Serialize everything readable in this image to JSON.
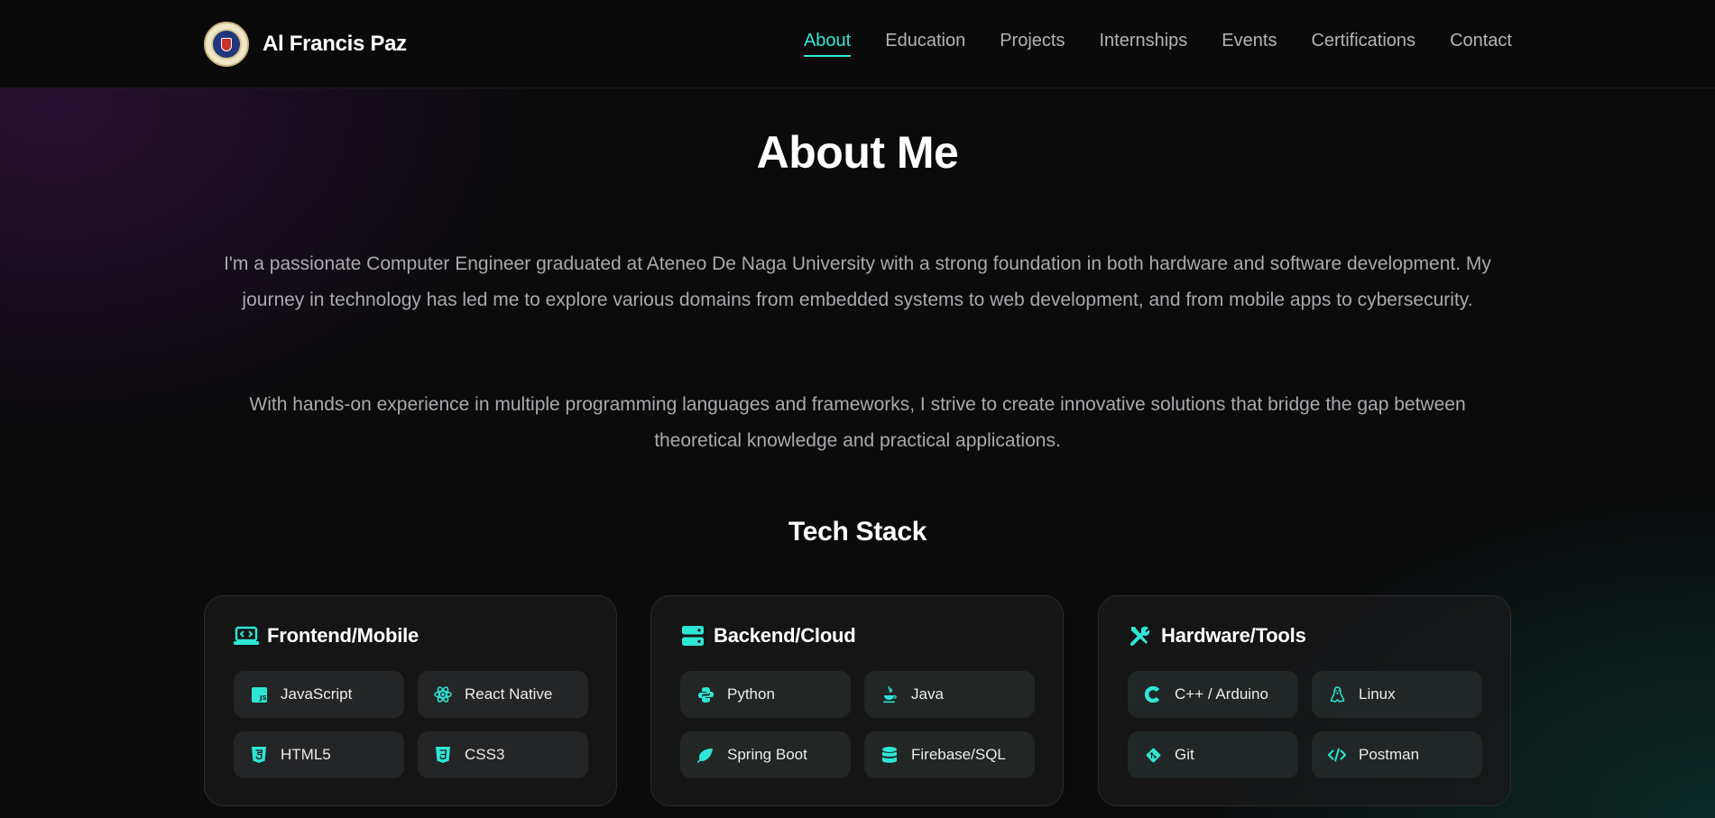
{
  "brand": {
    "name": "Al Francis Paz",
    "logo_icon": "university-seal-logo"
  },
  "nav": {
    "items": [
      {
        "label": "About",
        "active": true
      },
      {
        "label": "Education",
        "active": false
      },
      {
        "label": "Projects",
        "active": false
      },
      {
        "label": "Internships",
        "active": false
      },
      {
        "label": "Events",
        "active": false
      },
      {
        "label": "Certifications",
        "active": false
      },
      {
        "label": "Contact",
        "active": false
      }
    ]
  },
  "about": {
    "title": "About Me",
    "paragraphs": [
      "I'm a passionate Computer Engineer graduated at Ateneo De Naga University with a strong foundation in both hardware and software development. My journey in technology has led me to explore various domains from embedded systems to web development, and from mobile apps to cybersecurity.",
      "With hands-on experience in multiple programming languages and frameworks, I strive to create innovative solutions that bridge the gap between theoretical knowledge and practical applications."
    ]
  },
  "tech_stack": {
    "title": "Tech Stack",
    "categories": [
      {
        "title": "Frontend/Mobile",
        "icon": "laptop-code-icon",
        "items": [
          {
            "label": "JavaScript",
            "icon": "javascript-icon"
          },
          {
            "label": "React Native",
            "icon": "react-icon"
          },
          {
            "label": "HTML5",
            "icon": "html5-icon"
          },
          {
            "label": "CSS3",
            "icon": "css3-icon"
          }
        ]
      },
      {
        "title": "Backend/Cloud",
        "icon": "server-icon",
        "items": [
          {
            "label": "Python",
            "icon": "python-icon"
          },
          {
            "label": "Java",
            "icon": "java-icon"
          },
          {
            "label": "Spring Boot",
            "icon": "leaf-icon"
          },
          {
            "label": "Firebase/SQL",
            "icon": "database-icon"
          }
        ]
      },
      {
        "title": "Hardware/Tools",
        "icon": "tools-icon",
        "items": [
          {
            "label": "C++ / Arduino",
            "icon": "c-icon"
          },
          {
            "label": "Linux",
            "icon": "linux-icon"
          },
          {
            "label": "Git",
            "icon": "git-icon"
          },
          {
            "label": "Postman",
            "icon": "code-brackets-icon"
          }
        ]
      }
    ]
  },
  "colors": {
    "accent": "#2ee6d6",
    "background": "#0b0b0c",
    "text_muted": "#a9a9ae"
  }
}
